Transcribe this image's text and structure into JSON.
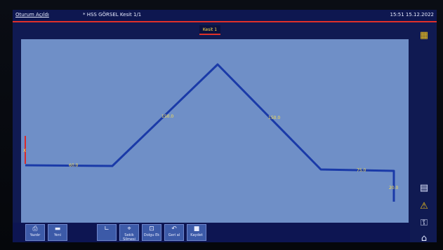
{
  "statusbar": {
    "user": "Oturum Açıldı",
    "program": "* HSS GÖRSEL Kesit 1/1",
    "datetime": "15:51 15.12.2022"
  },
  "tabs": [
    {
      "label": "Kesit 1",
      "active": true
    }
  ],
  "profile": {
    "segment_labels": [
      "60.0",
      "150.0",
      "150.0",
      "75.0",
      "20.0"
    ],
    "marker_label": "X"
  },
  "right_toolbar": [
    {
      "name": "keypad-icon",
      "glyph": "▦",
      "color": "#f2c21a"
    },
    {
      "name": "calculator-icon",
      "glyph": "▤",
      "color": "#dfe6ff"
    },
    {
      "name": "warning-icon",
      "glyph": "⚠",
      "color": "#f2c21a"
    },
    {
      "name": "user-lock-icon",
      "glyph": "⚿",
      "color": "#dfe6ff"
    },
    {
      "name": "home-icon",
      "glyph": "⌂",
      "color": "#dfe6ff"
    }
  ],
  "bottom_toolbar": [
    {
      "name": "print-button",
      "label": "Yazdır",
      "glyph": "⎙"
    },
    {
      "name": "new-button",
      "label": "Yeni",
      "glyph": "▬"
    },
    {
      "name": "angle-button",
      "label": "",
      "glyph": "∟"
    },
    {
      "name": "delete-sequence-button",
      "label": "Sekik Silmesi",
      "glyph": "⌖"
    },
    {
      "name": "insert-button",
      "label": "Dolgu Ek",
      "glyph": "⊡"
    },
    {
      "name": "undo-button",
      "label": "Geri al",
      "glyph": "↶"
    },
    {
      "name": "save-button",
      "label": "Kaydet",
      "glyph": "■"
    }
  ]
}
